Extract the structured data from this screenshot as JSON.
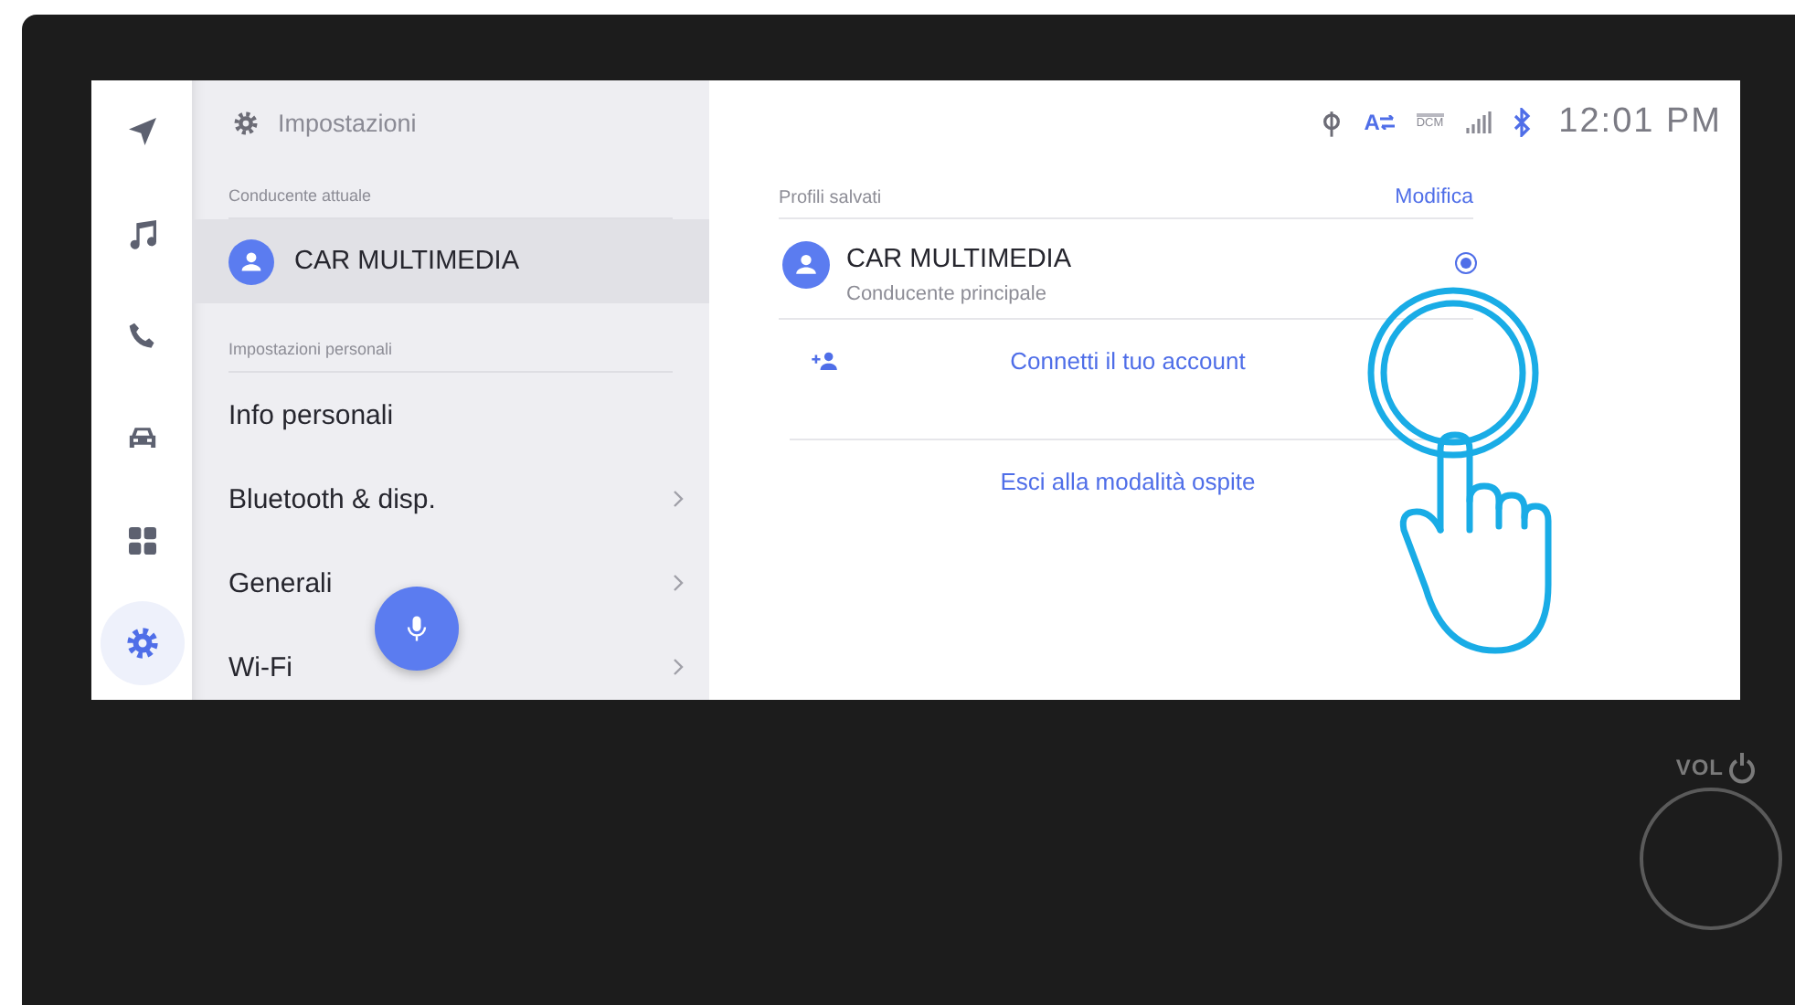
{
  "rail": [
    {
      "kind": "navigation",
      "selected": false
    },
    {
      "kind": "music",
      "selected": false
    },
    {
      "kind": "phone",
      "selected": false
    },
    {
      "kind": "car",
      "selected": false
    },
    {
      "kind": "apps",
      "selected": false
    },
    {
      "kind": "settings",
      "selected": true
    }
  ],
  "settings": {
    "title": "Impostazioni",
    "sections": [
      {
        "label": "Conducente attuale",
        "items": [
          {
            "kind": "profile",
            "label": "CAR MULTIMEDIA",
            "selected": true,
            "has_submenu": false
          }
        ]
      },
      {
        "label": "Impostazioni personali",
        "items": [
          {
            "kind": "entry",
            "label": "Info personali",
            "selected": false,
            "has_submenu": false
          },
          {
            "kind": "entry",
            "label": "Bluetooth & disp.",
            "selected": false,
            "has_submenu": true
          },
          {
            "kind": "entry",
            "label": "Generali",
            "selected": false,
            "has_submenu": true
          },
          {
            "kind": "entry",
            "label": "Wi-Fi",
            "selected": false,
            "has_submenu": true
          }
        ]
      }
    ]
  },
  "status_bar": {
    "language_letter": "A",
    "dcm_label": "DCM",
    "time": "12:01 PM"
  },
  "profiles": {
    "title": "Profili salvati",
    "edit_link": "Modifica",
    "items": [
      {
        "name": "CAR MULTIMEDIA",
        "role": "Conducente principale",
        "selected": true
      }
    ],
    "actions": [
      {
        "kind": "connect",
        "label": "Connetti il tuo account"
      },
      {
        "kind": "guest",
        "label": "Esci alla modalità ospite"
      }
    ]
  },
  "hardware": {
    "volume_label": "VOL"
  }
}
